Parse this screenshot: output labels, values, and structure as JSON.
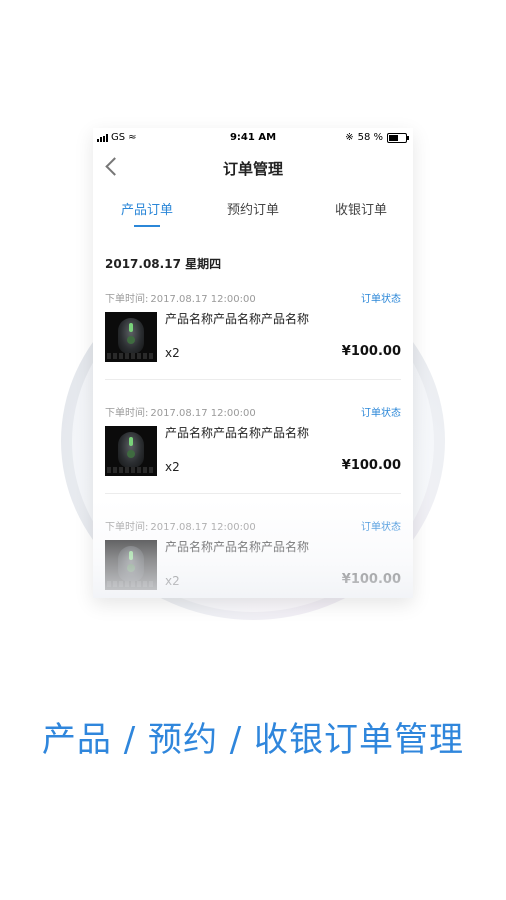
{
  "status_bar": {
    "carrier": "GS",
    "time": "9:41 AM",
    "battery": "58 %"
  },
  "header": {
    "title": "订单管理"
  },
  "tabs": [
    {
      "label": "产品订单",
      "active": true
    },
    {
      "label": "预约订单",
      "active": false
    },
    {
      "label": "收银订单",
      "active": false
    }
  ],
  "date_heading": "2017.08.17 星期四",
  "orders": [
    {
      "time_label": "下单时间:",
      "time": "2017.08.17 12:00:00",
      "status": "订单状态",
      "product": "产品名称产品名称产品名称",
      "qty": "x2",
      "price": "¥100.00"
    },
    {
      "time_label": "下单时间:",
      "time": "2017.08.17 12:00:00",
      "status": "订单状态",
      "product": "产品名称产品名称产品名称",
      "qty": "x2",
      "price": "¥100.00"
    },
    {
      "time_label": "下单时间:",
      "time": "2017.08.17 12:00:00",
      "status": "订单状态",
      "product": "产品名称产品名称产品名称",
      "qty": "x2",
      "price": "¥100.00"
    }
  ],
  "caption": "产品 / 预约 / 收银订单管理",
  "colors": {
    "accent": "#2b87d8",
    "caption": "#2f86dc"
  }
}
